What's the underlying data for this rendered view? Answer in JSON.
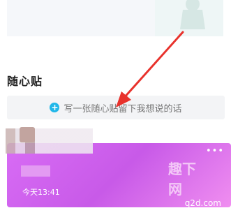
{
  "section": {
    "title": "随心贴"
  },
  "add_note": {
    "label": "写一张随心贴留下我想说的话",
    "icon": "plus-circle-icon",
    "icon_color": "#21b7e9"
  },
  "note_card": {
    "time": "今天13:41",
    "menu": "•••"
  },
  "watermark": {
    "title": "趣下网",
    "domain": "q2d.com"
  },
  "colors": {
    "arrow": "#e8322c",
    "card_gradient_start": "#d86cf5",
    "card_gradient_end": "#f08ef0"
  }
}
